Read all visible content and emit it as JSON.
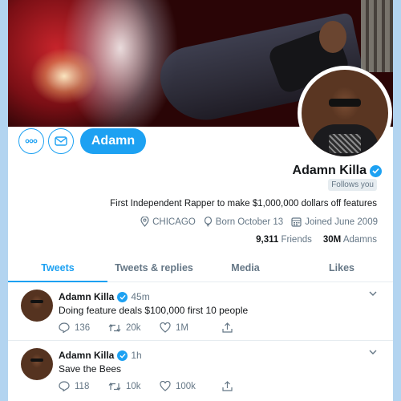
{
  "profile": {
    "display_name": "Adamn Killa",
    "follows_you": "Follows you",
    "bio": "First Independent Rapper to make $1,000,000 dollars off features",
    "location": "CHICAGO",
    "birthday": "Born October 13",
    "joined": "Joined June 2009",
    "friends_count": "9,311",
    "friends_label": "Friends",
    "followers_count": "30M",
    "followers_label": "Adamns",
    "follow_button": "Adamn",
    "verified": true
  },
  "colors": {
    "accent": "#1da1f2",
    "text": "#14171a",
    "muted": "#657786",
    "page_background": "#b3d4f0"
  },
  "icons": {
    "more": "more-dots-icon",
    "message": "envelope-icon",
    "verified": "verified-badge-icon",
    "location": "location-pin-icon",
    "birthday": "balloon-icon",
    "joined": "calendar-icon",
    "reply": "reply-icon",
    "retweet": "retweet-icon",
    "like": "heart-icon",
    "share": "share-icon",
    "menu": "chevron-down-icon"
  },
  "tabs": [
    {
      "label": "Tweets",
      "active": true
    },
    {
      "label": "Tweets & replies",
      "active": false
    },
    {
      "label": "Media",
      "active": false
    },
    {
      "label": "Likes",
      "active": false
    }
  ],
  "tweets": [
    {
      "author": "Adamn Killa",
      "time": "45m",
      "text": "Doing feature deals $100,000 first 10 people",
      "replies": "136",
      "retweets": "20k",
      "likes": "1M"
    },
    {
      "author": "Adamn Killa",
      "time": "1h",
      "text": "Save the Bees",
      "replies": "118",
      "retweets": "10k",
      "likes": "100k"
    }
  ]
}
